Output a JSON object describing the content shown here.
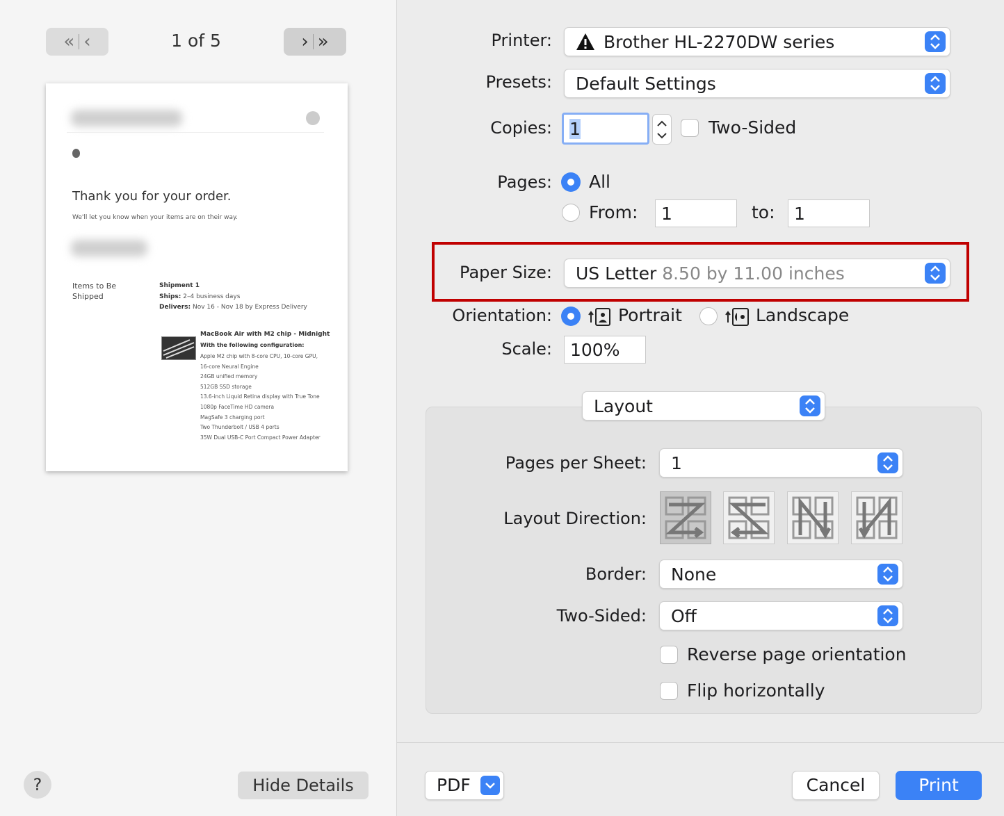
{
  "preview": {
    "page_indicator": "1 of 5",
    "document": {
      "heading": "Thank you for your order.",
      "subheading": "We'll let you know when your items are on their way.",
      "items_label": "Items to Be Shipped",
      "shipment_title": "Shipment 1",
      "ships_label": "Ships:",
      "ships_value": "2–4 business days",
      "delivers_label": "Delivers:",
      "delivers_value": "Nov 16 - Nov 18 by Express Delivery",
      "product_title": "MacBook Air with M2 chip - Midnight",
      "config_label": "With the following configuration:",
      "config_lines": [
        "Apple M2 chip with 8-core CPU, 10-core GPU,",
        "16-core Neural Engine",
        "24GB unified memory",
        "512GB SSD storage",
        "13.6-inch Liquid Retina display with True Tone",
        "1080p FaceTime HD camera",
        "MagSafe 3 charging port",
        "Two Thunderbolt / USB 4 ports",
        "35W Dual USB-C Port Compact Power Adapter"
      ]
    }
  },
  "left_footer": {
    "help": "?",
    "hide_details": "Hide Details"
  },
  "printer": {
    "label": "Printer:",
    "value": "Brother HL-2270DW series"
  },
  "presets": {
    "label": "Presets:",
    "value": "Default Settings"
  },
  "copies": {
    "label": "Copies:",
    "value": "1",
    "two_sided_label": "Two-Sided"
  },
  "pages": {
    "label": "Pages:",
    "all_label": "All",
    "from_label": "From:",
    "from_value": "1",
    "to_label": "to:",
    "to_value": "1",
    "selected": "All"
  },
  "paper_size": {
    "label": "Paper Size:",
    "name": "US Letter",
    "dimensions": "8.50 by 11.00 inches"
  },
  "orientation": {
    "label": "Orientation:",
    "portrait": "Portrait",
    "landscape": "Landscape",
    "selected": "Portrait"
  },
  "scale": {
    "label": "Scale:",
    "value": "100%"
  },
  "section_popup": "Layout",
  "layout": {
    "pages_per_sheet_label": "Pages per Sheet:",
    "pages_per_sheet_value": "1",
    "layout_direction_label": "Layout Direction:",
    "border_label": "Border:",
    "border_value": "None",
    "two_sided_label": "Two-Sided:",
    "two_sided_value": "Off",
    "reverse_label": "Reverse page orientation",
    "flip_label": "Flip horizontally"
  },
  "footer": {
    "pdf": "PDF",
    "cancel": "Cancel",
    "print": "Print"
  },
  "colors": {
    "accent": "#3b82f6",
    "highlight": "#c00000"
  }
}
